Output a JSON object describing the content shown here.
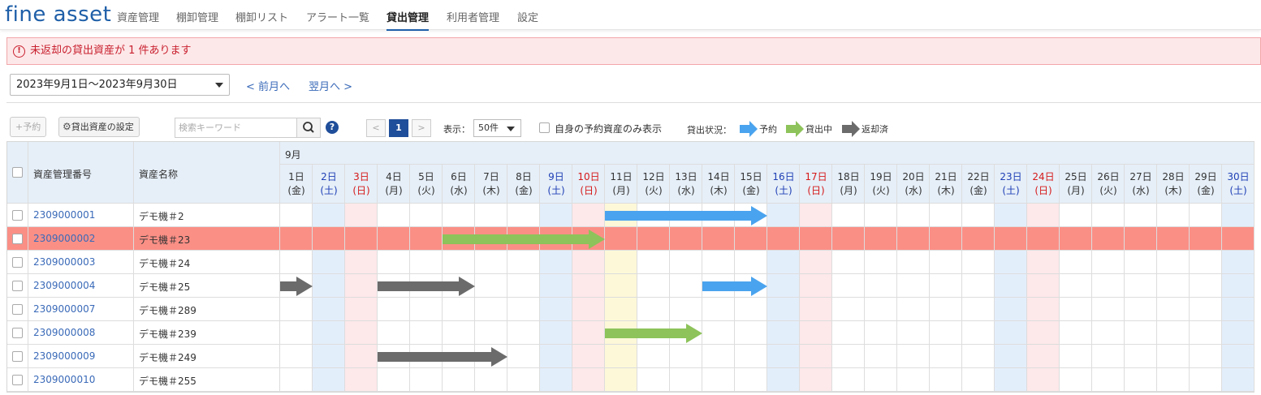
{
  "brand": {
    "logo": "fine asset",
    "accent": "#1f5fa8"
  },
  "nav": [
    {
      "label": "資産管理",
      "active": false
    },
    {
      "label": "棚卸管理",
      "active": false
    },
    {
      "label": "棚卸リスト",
      "active": false
    },
    {
      "label": "アラート一覧",
      "active": false
    },
    {
      "label": "貸出管理",
      "active": true
    },
    {
      "label": "利用者管理",
      "active": false
    },
    {
      "label": "設定",
      "active": false
    }
  ],
  "alert": {
    "icon": "exclamation-circle-icon",
    "text": "未返却の貸出資産が 1 件あります",
    "color": "#c8212f"
  },
  "period": {
    "selected": "2023年9月1日～2023年9月30日",
    "prev_label": "< 前月へ",
    "next_label": "翌月へ >"
  },
  "toolbar": {
    "reserve_label": "+予約",
    "settings_label": "貸出資産の設定",
    "search_placeholder": "検索キーワード",
    "help": "?",
    "page_prev": "<",
    "page_current": "1",
    "page_next": ">",
    "display_label": "表示：",
    "per_page": "50件",
    "own_only_label": "自身の予約資産のみ表示",
    "status_label": "貸出状況：",
    "legend": [
      {
        "label": "予約",
        "color": "#4aa3ee"
      },
      {
        "label": "貸出中",
        "color": "#8dc35a"
      },
      {
        "label": "返却済",
        "color": "#6b6b6b"
      }
    ]
  },
  "table": {
    "col_asset_no": "資産管理番号",
    "col_asset_name": "資産名称",
    "month_label": "9月",
    "days": [
      {
        "d": "1日",
        "w": "(金)",
        "t": "wd"
      },
      {
        "d": "2日",
        "w": "(土)",
        "t": "sat"
      },
      {
        "d": "3日",
        "w": "(日)",
        "t": "sun"
      },
      {
        "d": "4日",
        "w": "(月)",
        "t": "wd"
      },
      {
        "d": "5日",
        "w": "(火)",
        "t": "wd"
      },
      {
        "d": "6日",
        "w": "(水)",
        "t": "wd"
      },
      {
        "d": "7日",
        "w": "(木)",
        "t": "wd"
      },
      {
        "d": "8日",
        "w": "(金)",
        "t": "wd"
      },
      {
        "d": "9日",
        "w": "(土)",
        "t": "sat"
      },
      {
        "d": "10日",
        "w": "(日)",
        "t": "sun"
      },
      {
        "d": "11日",
        "w": "(月)",
        "t": "wd"
      },
      {
        "d": "12日",
        "w": "(火)",
        "t": "wd"
      },
      {
        "d": "13日",
        "w": "(水)",
        "t": "wd"
      },
      {
        "d": "14日",
        "w": "(木)",
        "t": "wd"
      },
      {
        "d": "15日",
        "w": "(金)",
        "t": "wd"
      },
      {
        "d": "16日",
        "w": "(土)",
        "t": "sat"
      },
      {
        "d": "17日",
        "w": "(日)",
        "t": "sun"
      },
      {
        "d": "18日",
        "w": "(月)",
        "t": "wd"
      },
      {
        "d": "19日",
        "w": "(火)",
        "t": "wd"
      },
      {
        "d": "20日",
        "w": "(水)",
        "t": "wd"
      },
      {
        "d": "21日",
        "w": "(木)",
        "t": "wd"
      },
      {
        "d": "22日",
        "w": "(金)",
        "t": "wd"
      },
      {
        "d": "23日",
        "w": "(土)",
        "t": "sat"
      },
      {
        "d": "24日",
        "w": "(日)",
        "t": "sun"
      },
      {
        "d": "25日",
        "w": "(月)",
        "t": "wd"
      },
      {
        "d": "26日",
        "w": "(火)",
        "t": "wd"
      },
      {
        "d": "27日",
        "w": "(水)",
        "t": "wd"
      },
      {
        "d": "28日",
        "w": "(木)",
        "t": "wd"
      },
      {
        "d": "29日",
        "w": "(金)",
        "t": "wd"
      },
      {
        "d": "30日",
        "w": "(土)",
        "t": "sat"
      }
    ],
    "today": 11,
    "rows": [
      {
        "no": "2309000001",
        "name": "デモ機＃2",
        "overdue": false,
        "loans": [
          {
            "status": "reserved",
            "from": 11,
            "to": 15
          }
        ]
      },
      {
        "no": "2309000002",
        "name": "デモ機＃23",
        "overdue": true,
        "loans": [
          {
            "status": "on_loan",
            "from": 6,
            "to": 10
          }
        ]
      },
      {
        "no": "2309000003",
        "name": "デモ機＃24",
        "overdue": false,
        "loans": []
      },
      {
        "no": "2309000004",
        "name": "デモ機＃25",
        "overdue": false,
        "loans": [
          {
            "status": "returned",
            "from": 1,
            "to": 1
          },
          {
            "status": "returned",
            "from": 4,
            "to": 6
          },
          {
            "status": "reserved",
            "from": 14,
            "to": 15
          }
        ]
      },
      {
        "no": "2309000007",
        "name": "デモ機＃289",
        "overdue": false,
        "loans": []
      },
      {
        "no": "2309000008",
        "name": "デモ機＃239",
        "overdue": false,
        "loans": [
          {
            "status": "on_loan",
            "from": 11,
            "to": 13
          }
        ]
      },
      {
        "no": "2309000009",
        "name": "デモ機＃249",
        "overdue": false,
        "loans": [
          {
            "status": "returned",
            "from": 4,
            "to": 7
          }
        ]
      },
      {
        "no": "2309000010",
        "name": "デモ機＃255",
        "overdue": false,
        "loans": []
      }
    ]
  },
  "colors": {
    "reserved": "#4aa3ee",
    "on_loan": "#8dc35a",
    "returned": "#6b6b6b",
    "overdue_row": "#fa8f86",
    "saturday_bg": "#e3eefb",
    "sunday_bg": "#fde8ea",
    "today_bg": "#fdf8d8"
  }
}
